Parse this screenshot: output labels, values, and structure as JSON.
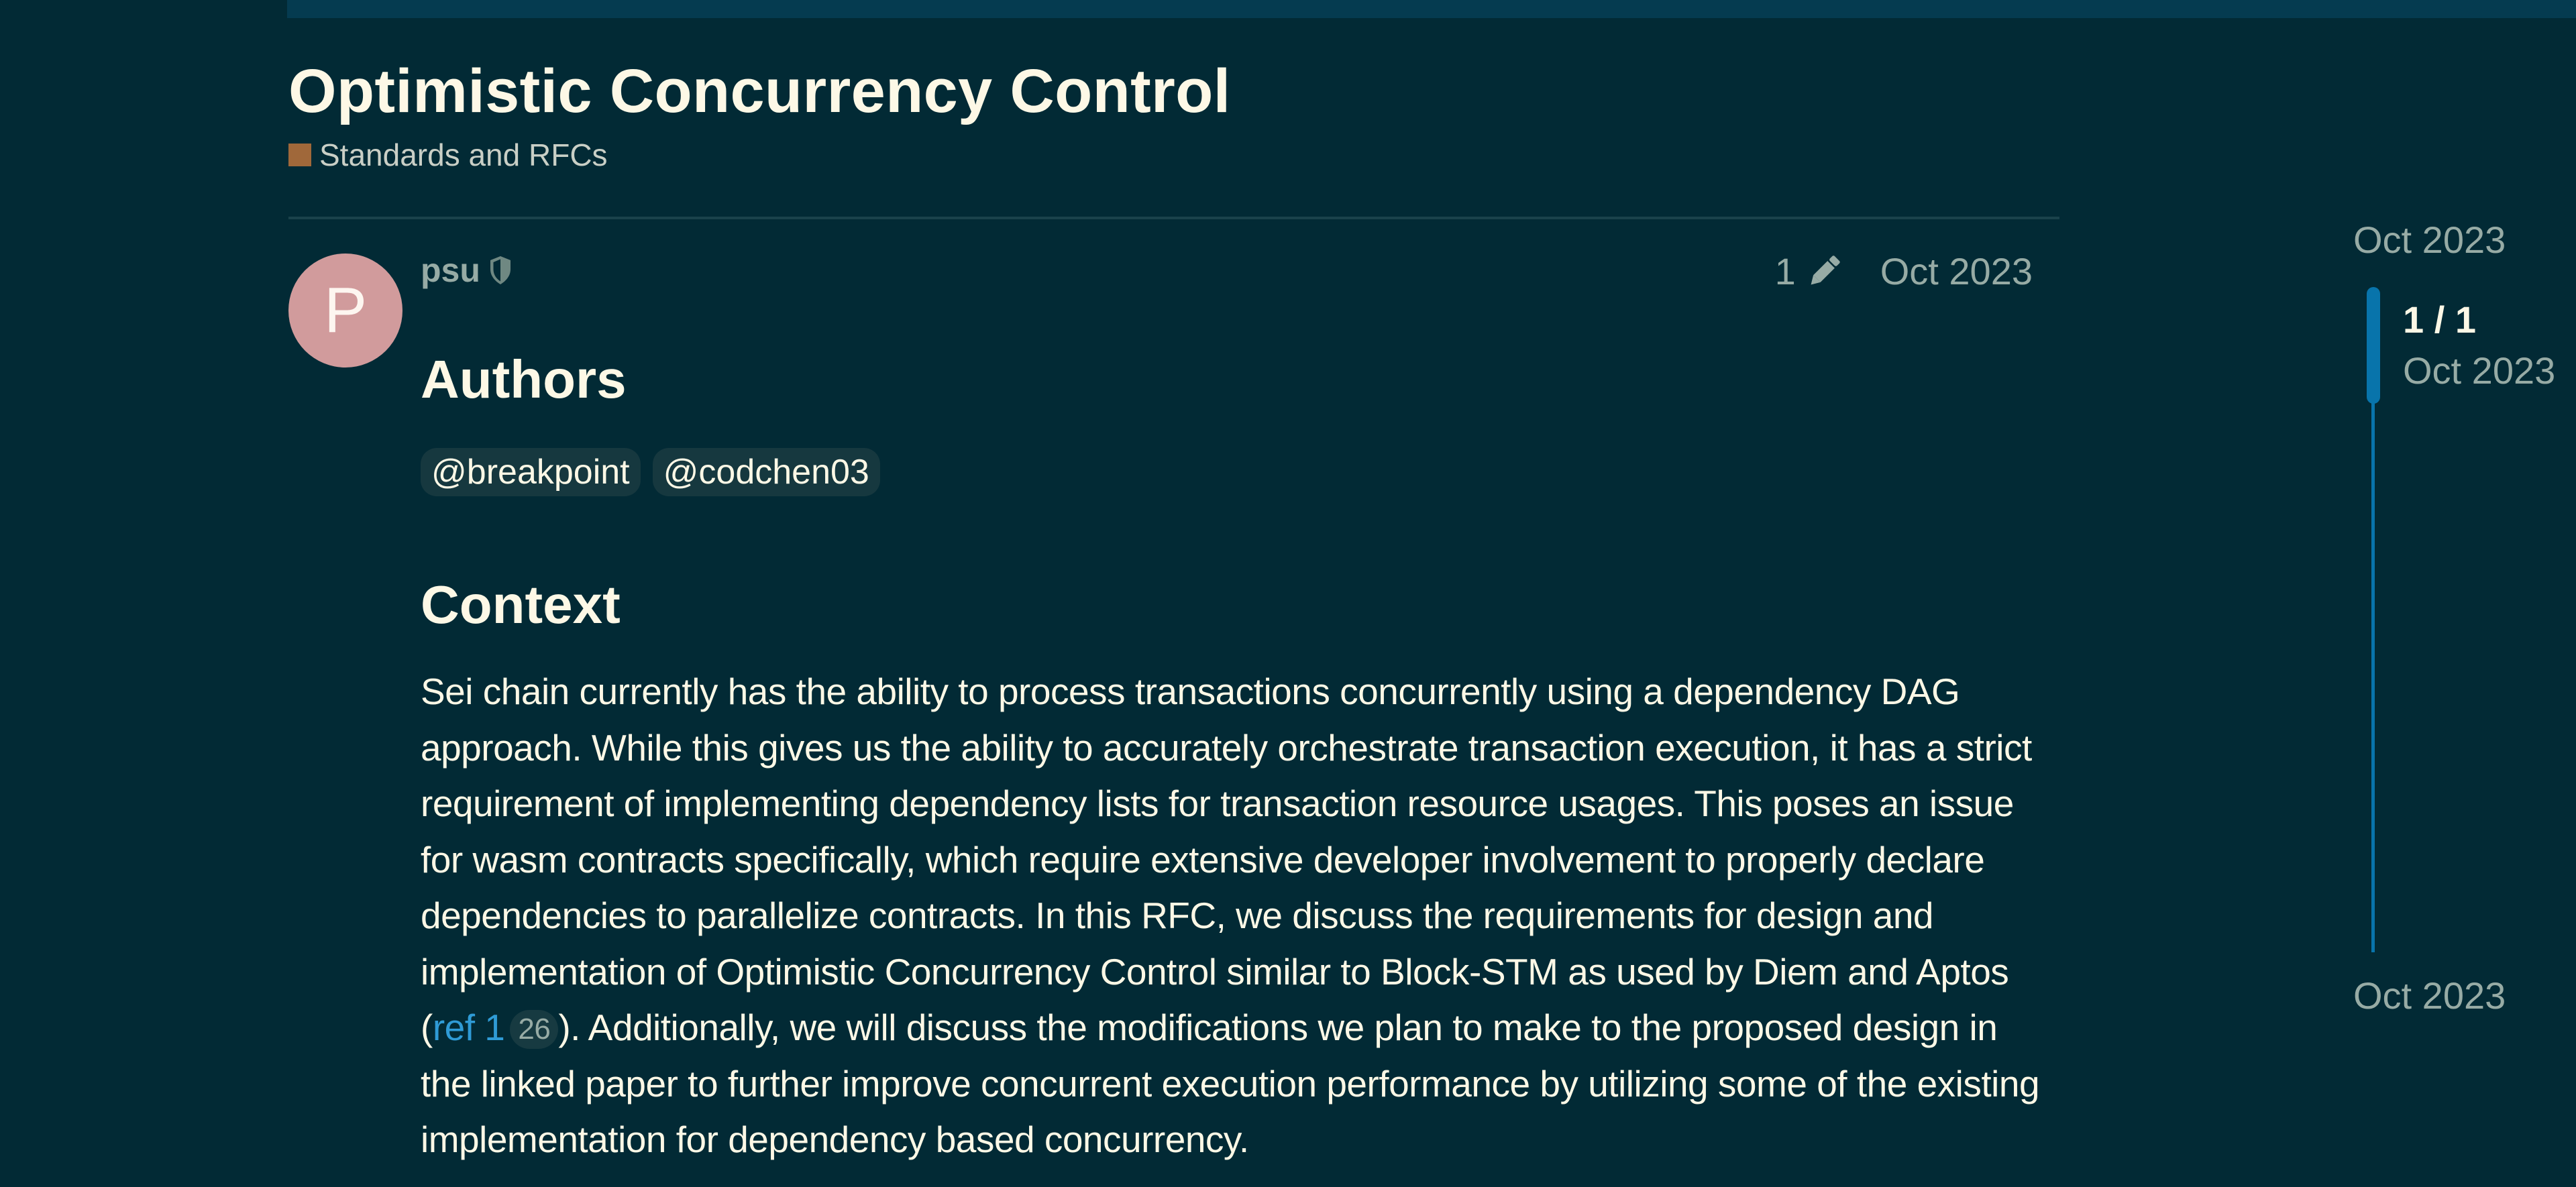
{
  "topic": {
    "title": "Optimistic Concurrency Control",
    "category": {
      "label": "Standards and RFCs",
      "color": "#a0683a"
    }
  },
  "post": {
    "avatar_letter": "P",
    "avatar_color": "#d19b9c",
    "username": "psu",
    "user_badge_icon": "shield-icon",
    "edit_count": "1",
    "edit_icon": "pencil-icon",
    "date": "Oct 2023",
    "authors_heading": "Authors",
    "mentions": [
      "@breakpoint",
      "@codchen03"
    ],
    "context_heading": "Context",
    "paragraph": {
      "before_link": "Sei chain currently has the ability to process transactions concurrently using a dependency DAG approach. While this gives us the ability to accurately orchestrate transaction execution, it has a strict requirement of implementing dependency lists for transaction resource usages. This poses an issue for wasm contracts specifically, which require extensive developer involvement to properly declare dependencies to parallelize contracts. In this RFC, we discuss the requirements for design and implementation of Optimistic Concurrency Control similar to Block-STM as used by Diem and Aptos (",
      "link_text": "ref 1",
      "link_clicks": "26",
      "after_link": "). Additionally, we will discuss the modifications we plan to make to the proposed design in the linked paper to further improve concurrent execution performance by utilizing some of the existing implementation for dependency based concurrency."
    }
  },
  "timeline": {
    "start_date": "Oct 2023",
    "counter": "1 / 1",
    "counter_date": "Oct 2023",
    "end_date": "Oct 2023",
    "accent_color": "#0874ab"
  }
}
